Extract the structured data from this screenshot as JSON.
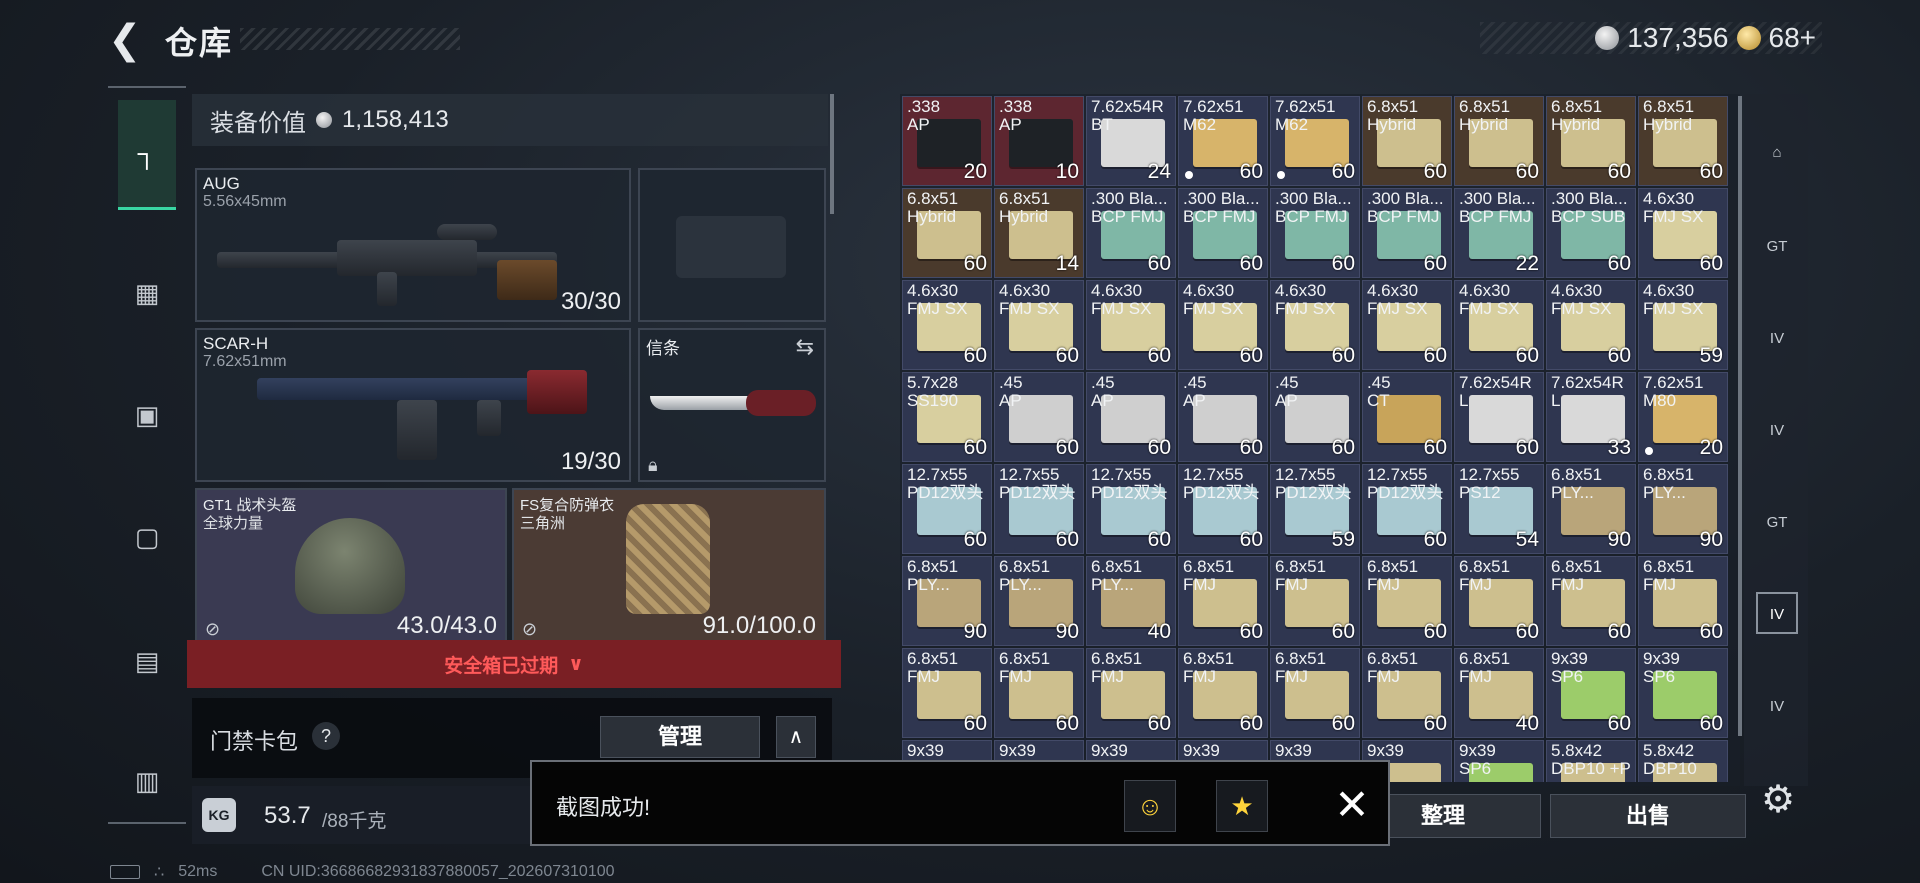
{
  "header": {
    "back_icon": "back-arrow-icon",
    "title": "仓库",
    "currency_main": "137,356",
    "currency_premium": "68+",
    "plus_label": "+"
  },
  "left_nav": {
    "items": [
      {
        "icon": "pistol-icon",
        "active": true
      },
      {
        "icon": "vest-icon"
      },
      {
        "icon": "backpack-icon"
      },
      {
        "icon": "pouch-icon"
      },
      {
        "icon": "case-icon"
      },
      {
        "icon": "toolbox-icon"
      }
    ]
  },
  "equipment": {
    "value_label": "装备价值",
    "value": "1,158,413",
    "primary": {
      "name": "AUG",
      "caliber": "5.56x45mm",
      "ammo": "30/30"
    },
    "secondary": {
      "name": "SCAR-H",
      "caliber": "7.62x51mm",
      "ammo": "19/30"
    },
    "melee": {
      "name": "信条"
    },
    "helmet": {
      "name": "GT1 战术头盔",
      "sub": "全球力量",
      "durability": "43.0/43.0"
    },
    "armor": {
      "name": "FS复合防弹衣",
      "sub": "三角洲",
      "durability": "91.0/100.0"
    }
  },
  "safebox": {
    "text": "安全箱已过期",
    "chevron_icon": "double-chevron-down-icon"
  },
  "access_card": {
    "label": "门禁卡包",
    "help": "?",
    "manage": "管理",
    "collapse_icon": "chevron-up-icon"
  },
  "weight": {
    "icon_text": "KG",
    "current": "53.7",
    "max": "/88千克"
  },
  "status": {
    "ping": "52ms",
    "uid": "CN UID:36686682931837880057_202607310100"
  },
  "inventory": {
    "rows": [
      [
        {
          "l1": ".338",
          "l2": "AP",
          "qty": "20",
          "bg": "red",
          "box": "#1e2226"
        },
        {
          "l1": ".338",
          "l2": "AP",
          "qty": "10",
          "bg": "red",
          "box": "#1e2226"
        },
        {
          "l1": "7.62x54R",
          "l2": "BT",
          "qty": "24",
          "box": "#d9d9d9"
        },
        {
          "l1": "7.62x51",
          "l2": "M62",
          "qty": "60",
          "dot": true,
          "box": "#d7b46a"
        },
        {
          "l1": "7.62x51",
          "l2": "M62",
          "qty": "60",
          "dot": true,
          "box": "#d7b46a"
        },
        {
          "l1": "6.8x51",
          "l2": "Hybrid",
          "qty": "60",
          "bg": "brown",
          "box": "#cdbf8e"
        },
        {
          "l1": "6.8x51",
          "l2": "Hybrid",
          "qty": "60",
          "bg": "brown",
          "box": "#cdbf8e"
        },
        {
          "l1": "6.8x51",
          "l2": "Hybrid",
          "qty": "60",
          "bg": "brown",
          "box": "#cdbf8e"
        },
        {
          "l1": "6.8x51",
          "l2": "Hybrid",
          "qty": "60",
          "bg": "brown",
          "box": "#cdbf8e"
        }
      ],
      [
        {
          "l1": "6.8x51",
          "l2": "Hybrid",
          "qty": "60",
          "bg": "brown",
          "box": "#cdbf8e"
        },
        {
          "l1": "6.8x51",
          "l2": "Hybrid",
          "qty": "14",
          "bg": "brown",
          "box": "#cdbf8e"
        },
        {
          "l1": ".300 Bla...",
          "l2": "BCP FMJ",
          "qty": "60",
          "box": "#7fb7a6"
        },
        {
          "l1": ".300 Bla...",
          "l2": "BCP FMJ",
          "qty": "60",
          "box": "#7fb7a6"
        },
        {
          "l1": ".300 Bla...",
          "l2": "BCP FMJ",
          "qty": "60",
          "box": "#7fb7a6"
        },
        {
          "l1": ".300 Bla...",
          "l2": "BCP FMJ",
          "qty": "60",
          "box": "#7fb7a6"
        },
        {
          "l1": ".300 Bla...",
          "l2": "BCP FMJ",
          "qty": "22",
          "box": "#7fb7a6"
        },
        {
          "l1": ".300 Bla...",
          "l2": "BCP SUB",
          "qty": "60",
          "box": "#7fb7a6"
        },
        {
          "l1": "4.6x30",
          "l2": "FMJ SX",
          "qty": "60",
          "box": "#d8cf9f"
        }
      ],
      [
        {
          "l1": "4.6x30",
          "l2": "FMJ SX",
          "qty": "60",
          "box": "#d8cf9f"
        },
        {
          "l1": "4.6x30",
          "l2": "FMJ SX",
          "qty": "60",
          "box": "#d8cf9f"
        },
        {
          "l1": "4.6x30",
          "l2": "FMJ SX",
          "qty": "60",
          "box": "#d8cf9f"
        },
        {
          "l1": "4.6x30",
          "l2": "FMJ SX",
          "qty": "60",
          "box": "#d8cf9f"
        },
        {
          "l1": "4.6x30",
          "l2": "FMJ SX",
          "qty": "60",
          "box": "#d8cf9f"
        },
        {
          "l1": "4.6x30",
          "l2": "FMJ SX",
          "qty": "60",
          "box": "#d8cf9f"
        },
        {
          "l1": "4.6x30",
          "l2": "FMJ SX",
          "qty": "60",
          "box": "#d8cf9f"
        },
        {
          "l1": "4.6x30",
          "l2": "FMJ SX",
          "qty": "60",
          "box": "#d8cf9f"
        },
        {
          "l1": "4.6x30",
          "l2": "FMJ SX",
          "qty": "59",
          "box": "#d8cf9f"
        }
      ],
      [
        {
          "l1": "5.7x28",
          "l2": "SS190",
          "qty": "60",
          "box": "#d8cf9f"
        },
        {
          "l1": ".45",
          "l2": "AP",
          "qty": "60",
          "box": "#cfcfcf"
        },
        {
          "l1": ".45",
          "l2": "AP",
          "qty": "60",
          "box": "#cfcfcf"
        },
        {
          "l1": ".45",
          "l2": "AP",
          "qty": "60",
          "box": "#cfcfcf"
        },
        {
          "l1": ".45",
          "l2": "AP",
          "qty": "60",
          "box": "#cfcfcf"
        },
        {
          "l1": ".45",
          "l2": "CT",
          "qty": "60",
          "box": "#c8a45a"
        },
        {
          "l1": "7.62x54R",
          "l2": "L",
          "qty": "60",
          "box": "#d9d9d9"
        },
        {
          "l1": "7.62x54R",
          "l2": "L",
          "qty": "33",
          "box": "#d9d9d9"
        },
        {
          "l1": "7.62x51",
          "l2": "M80",
          "qty": "20",
          "dot": true,
          "box": "#d7b46a"
        }
      ],
      [
        {
          "l1": "12.7x55",
          "l2": "PD12双头",
          "qty": "60",
          "box": "#a9c9d1"
        },
        {
          "l1": "12.7x55",
          "l2": "PD12双头",
          "qty": "60",
          "box": "#a9c9d1"
        },
        {
          "l1": "12.7x55",
          "l2": "PD12双头",
          "qty": "60",
          "box": "#a9c9d1"
        },
        {
          "l1": "12.7x55",
          "l2": "PD12双头",
          "qty": "60",
          "box": "#a9c9d1"
        },
        {
          "l1": "12.7x55",
          "l2": "PD12双头",
          "qty": "59",
          "box": "#a9c9d1"
        },
        {
          "l1": "12.7x55",
          "l2": "PD12双头",
          "qty": "60",
          "box": "#a9c9d1"
        },
        {
          "l1": "12.7x55",
          "l2": "PS12",
          "qty": "54",
          "box": "#a9c9d1"
        },
        {
          "l1": "6.8x51",
          "l2": "PLY...",
          "qty": "90",
          "box": "#b9a57a"
        },
        {
          "l1": "6.8x51",
          "l2": "PLY...",
          "qty": "90",
          "box": "#b9a57a"
        }
      ],
      [
        {
          "l1": "6.8x51",
          "l2": "PLY...",
          "qty": "90",
          "box": "#b9a57a"
        },
        {
          "l1": "6.8x51",
          "l2": "PLY...",
          "qty": "90",
          "box": "#b9a57a"
        },
        {
          "l1": "6.8x51",
          "l2": "PLY...",
          "qty": "40",
          "box": "#b9a57a"
        },
        {
          "l1": "6.8x51",
          "l2": "FMJ",
          "qty": "60",
          "box": "#cdbf8e"
        },
        {
          "l1": "6.8x51",
          "l2": "FMJ",
          "qty": "60",
          "box": "#cdbf8e"
        },
        {
          "l1": "6.8x51",
          "l2": "FMJ",
          "qty": "60",
          "box": "#cdbf8e"
        },
        {
          "l1": "6.8x51",
          "l2": "FMJ",
          "qty": "60",
          "box": "#cdbf8e"
        },
        {
          "l1": "6.8x51",
          "l2": "FMJ",
          "qty": "60",
          "box": "#cdbf8e"
        },
        {
          "l1": "6.8x51",
          "l2": "FMJ",
          "qty": "60",
          "box": "#cdbf8e"
        }
      ],
      [
        {
          "l1": "6.8x51",
          "l2": "FMJ",
          "qty": "60",
          "box": "#cdbf8e"
        },
        {
          "l1": "6.8x51",
          "l2": "FMJ",
          "qty": "60",
          "box": "#cdbf8e"
        },
        {
          "l1": "6.8x51",
          "l2": "FMJ",
          "qty": "60",
          "box": "#cdbf8e"
        },
        {
          "l1": "6.8x51",
          "l2": "FMJ",
          "qty": "60",
          "box": "#cdbf8e"
        },
        {
          "l1": "6.8x51",
          "l2": "FMJ",
          "qty": "60",
          "box": "#cdbf8e"
        },
        {
          "l1": "6.8x51",
          "l2": "FMJ",
          "qty": "60",
          "box": "#cdbf8e"
        },
        {
          "l1": "6.8x51",
          "l2": "FMJ",
          "qty": "40",
          "box": "#cdbf8e"
        },
        {
          "l1": "9x39",
          "l2": "SP6",
          "qty": "60",
          "box": "#9ccc6a"
        },
        {
          "l1": "9x39",
          "l2": "SP6",
          "qty": "60",
          "box": "#9ccc6a"
        }
      ],
      [
        {
          "l1": "9x39",
          "l2": "",
          "qty": "",
          "box": "#cdbf8e"
        },
        {
          "l1": "9x39",
          "l2": "",
          "qty": "",
          "box": "#cdbf8e"
        },
        {
          "l1": "9x39",
          "l2": "",
          "qty": "",
          "box": "#cdbf8e"
        },
        {
          "l1": "9x39",
          "l2": "",
          "qty": "",
          "box": "#cdbf8e"
        },
        {
          "l1": "9x39",
          "l2": "",
          "qty": "",
          "box": "#cdbf8e"
        },
        {
          "l1": "9x39",
          "l2": "",
          "qty": "",
          "box": "#cdbf8e"
        },
        {
          "l1": "9x39",
          "l2": "SP6",
          "qty": "",
          "box": "#9ccc6a"
        },
        {
          "l1": "5.8x42",
          "l2": "DBP10 +P",
          "qty": "",
          "box": "#cdbf8e"
        },
        {
          "l1": "5.8x42",
          "l2": "DBP10",
          "qty": "",
          "box": "#cdbf8e"
        }
      ]
    ]
  },
  "right_rail": {
    "items": [
      {
        "icon": "helmet-category-icon",
        "label": ""
      },
      {
        "icon": "gt-armor-icon",
        "label": "GT"
      },
      {
        "icon": "iv-rig-icon",
        "label": "IV"
      },
      {
        "icon": "iv-rig-icon",
        "label": "IV"
      },
      {
        "icon": "gt-armor-icon",
        "label": "GT"
      },
      {
        "icon": "iv-rig-icon",
        "label": "IV",
        "active": true
      },
      {
        "icon": "iv-rig-icon",
        "label": "IV"
      }
    ]
  },
  "actions": {
    "sort": "整理",
    "sell": "出售",
    "settings_icon": "gear-icon"
  },
  "toast": {
    "text": "截图成功!",
    "qq_icon": "qq-penguin-icon",
    "star_icon": "star-share-icon",
    "close_icon": "close-icon"
  },
  "colors": {
    "accent": "#39d6a3",
    "warning_bg": "#7a1f24",
    "warning_text": "#ff5a5a"
  }
}
